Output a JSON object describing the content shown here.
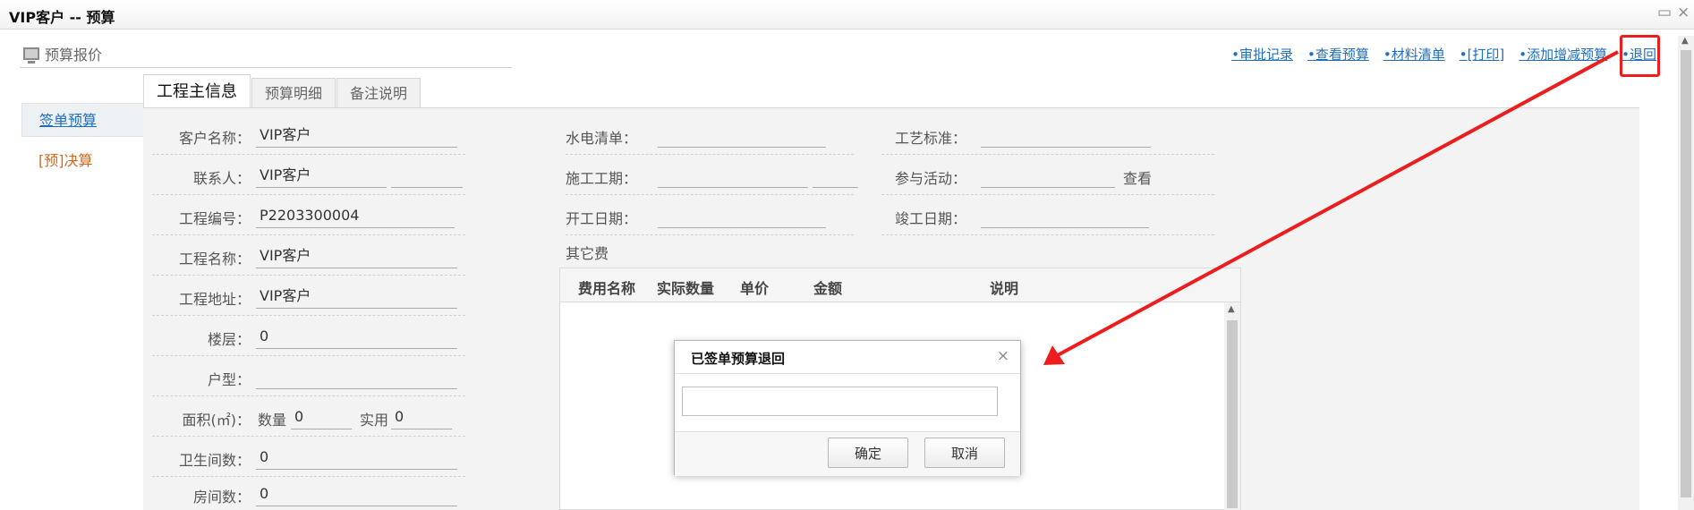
{
  "window": {
    "title": "VIP客户 -- 预算"
  },
  "breadcrumb": {
    "label": "预算报价"
  },
  "toplinks": [
    "•审批记录",
    "•查看预算",
    "•材料清单",
    "•[打印]",
    "•添加增减预算",
    "•退回"
  ],
  "leftnav": {
    "items": [
      "签单预算",
      "[预]决算"
    ]
  },
  "tabs": [
    "工程主信息",
    "预算明细",
    "备注说明"
  ],
  "form_left": {
    "customer_name": {
      "label": "客户名称：",
      "value": "VIP客户"
    },
    "contact": {
      "label": "联系人：",
      "value": "VIP客户"
    },
    "project_no": {
      "label": "工程编号：",
      "value": "P2203300004"
    },
    "project_name": {
      "label": "工程名称：",
      "value": "VIP客户"
    },
    "project_address": {
      "label": "工程地址：",
      "value": "VIP客户"
    },
    "floor": {
      "label": "楼层：",
      "value": "0"
    },
    "house_type": {
      "label": "户型：",
      "value": ""
    },
    "area": {
      "label": "面积(㎡)：",
      "qty_label": "数量",
      "qty_value": "0",
      "actual_label": "实用",
      "actual_value": "0"
    },
    "bathrooms": {
      "label": "卫生间数：",
      "value": "0"
    },
    "rooms": {
      "label": "房间数：",
      "value": "0"
    }
  },
  "form_mid": {
    "utility_list": {
      "label": "水电清单："
    },
    "construction_period": {
      "label": "施工工期："
    },
    "start_date": {
      "label": "开工日期："
    }
  },
  "form_right": {
    "craft_standard": {
      "label": "工艺标准："
    },
    "activity": {
      "label": "参与活动：",
      "link": "查看"
    },
    "completion_date": {
      "label": "竣工日期："
    }
  },
  "other_fees": {
    "label": "其它费",
    "columns": [
      "费用名称",
      "实际数量",
      "单价",
      "金额",
      "说明"
    ]
  },
  "dialog": {
    "title": "已签单预算退回",
    "input_value": "",
    "confirm": "确定",
    "cancel": "取消"
  },
  "colors": {
    "annotation": "#ee1d1d",
    "link": "#1f6fbf",
    "accent_nav": "#d2691e"
  }
}
